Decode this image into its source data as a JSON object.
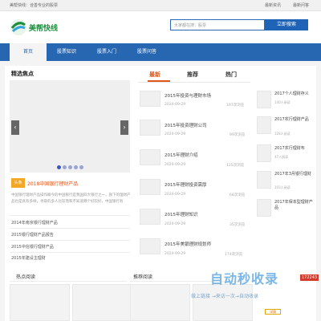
{
  "topbar": {
    "left_text": "美帮快线：诠善专业的股票",
    "links": [
      "最新资讯",
      "最新问答"
    ]
  },
  "header": {
    "logo_text": "美帮快线",
    "search_placeholder": "大家都在搜：股票",
    "search_button": "立即搜索",
    "colors": {
      "brand": "#1a8f3c",
      "accent": "#1e63b6"
    }
  },
  "nav": {
    "items": [
      "首页",
      "股票知识",
      "股票入门",
      "股票问答"
    ],
    "active_index": 0
  },
  "focus": {
    "title": "精选焦点",
    "slider": {
      "prev": "‹",
      "next": "›",
      "dots": 5,
      "active_dot": 0
    },
    "featured": {
      "badge": "头条",
      "title": "2018中国银行理财产品",
      "desc": "中国银行理财产品操作概今的中国银行是我国四大银行之一，旗下的理财产品也是具有多样，寻取的多人比较而和不知道哪个好较好，中国银行有"
    },
    "links": [
      "2014年南京银行理财产品",
      "2015银行理财产品报告",
      "2015中信银行理财产品",
      "2015年建设主理财"
    ]
  },
  "tabs": {
    "items": [
      "最新",
      "推荐",
      "热门"
    ],
    "active_index": 0
  },
  "articles": [
    {
      "title": "2015年投资与理财市场",
      "date": "2024-09-29",
      "views": "197次浏览"
    },
    {
      "title": "2015年投资理财公司",
      "date": "2024-09-29",
      "views": "99次浏览"
    },
    {
      "title": "2015年理财介绍",
      "date": "2024-09-29",
      "views": "125次浏览"
    },
    {
      "title": "2015年理财投资需厚",
      "date": "2024-09-29",
      "views": "68次浏览"
    },
    {
      "title": "2015年理财知识",
      "date": "2024-09-29",
      "views": "35次浏览"
    },
    {
      "title": "2015年美银理财规划师",
      "date": "2024-09-29",
      "views": "174次浏览"
    }
  ],
  "side_list": [
    {
      "title": "2017个人理财存义",
      "views": "140人阅读"
    },
    {
      "title": "2017农行理财产品",
      "views": "128人阅读"
    },
    {
      "title": "2017农行理财布",
      "views": "47人阅读"
    },
    {
      "title": "2017年3月银行理财",
      "views": "103人阅读"
    },
    {
      "title": "2017年保本型理财产品",
      "views": "172243"
    }
  ],
  "sections": {
    "hot_read": "热点阅读",
    "recommended": "推荐阅读"
  },
  "watermark": {
    "text": "自动秒收录",
    "sub": "做上链接 →来访一次→自动收录",
    "number": "172243",
    "detail_button": "详情"
  }
}
